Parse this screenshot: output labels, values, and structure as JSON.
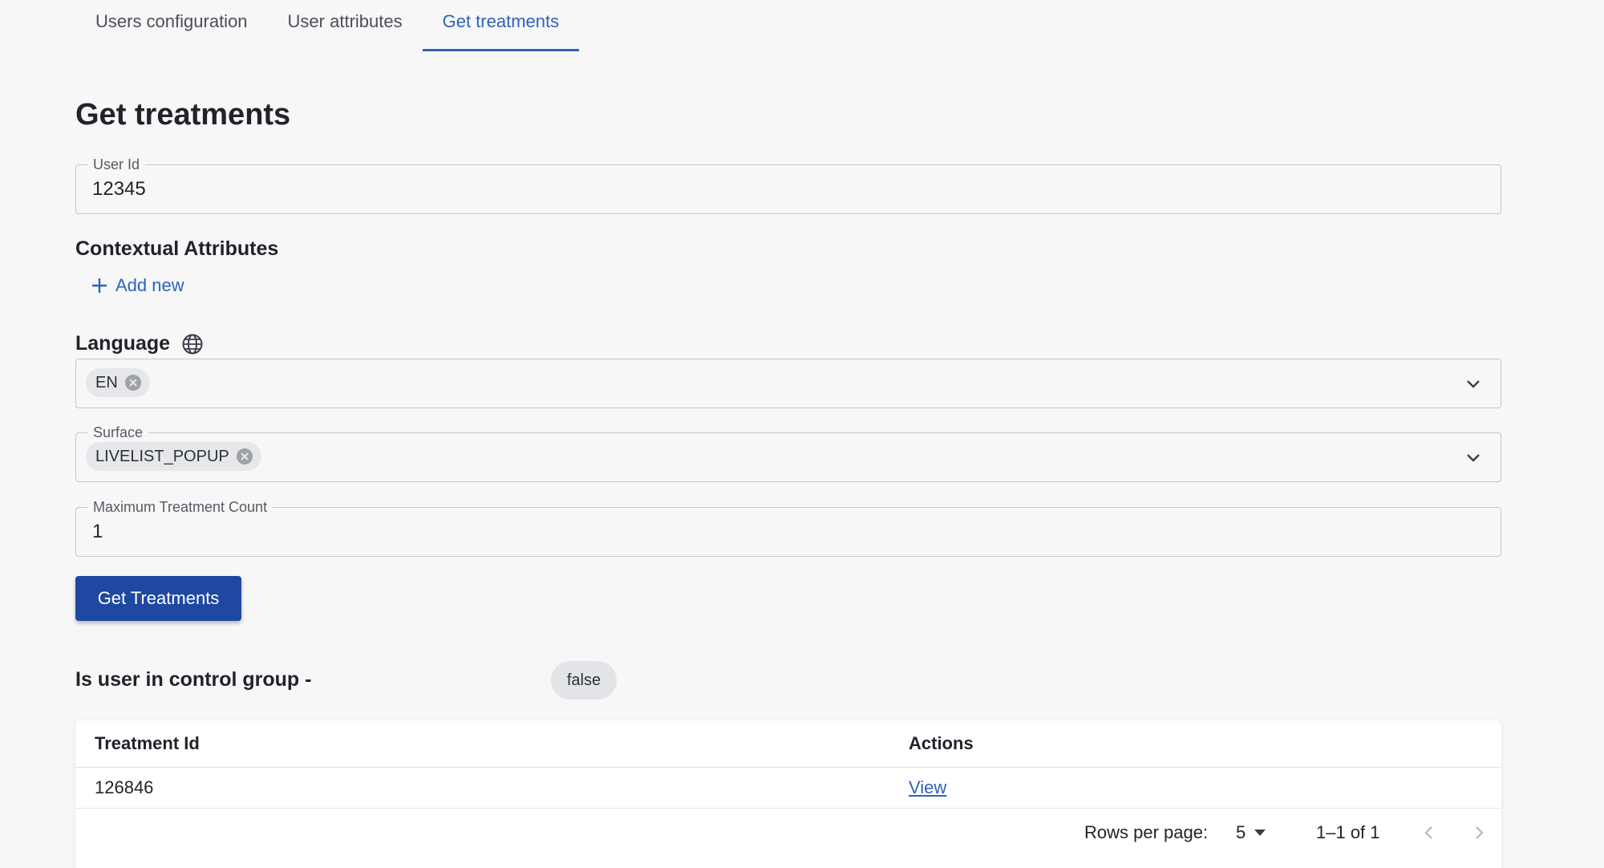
{
  "tabs": [
    {
      "label": "Users configuration"
    },
    {
      "label": "User attributes"
    },
    {
      "label": "Get treatments"
    }
  ],
  "page_title": "Get treatments",
  "user_id": {
    "label": "User Id",
    "value": "12345"
  },
  "contextual_attributes": {
    "heading": "Contextual Attributes",
    "add_label": "Add new"
  },
  "language": {
    "heading": "Language",
    "selected": "EN"
  },
  "surface": {
    "label": "Surface",
    "selected": "LIVELIST_POPUP"
  },
  "max_count": {
    "label": "Maximum Treatment Count",
    "value": "1"
  },
  "submit_label": "Get Treatments",
  "control_group": {
    "label": "Is user in control group -",
    "value": "false"
  },
  "table": {
    "columns": [
      "Treatment Id",
      "Actions"
    ],
    "rows": [
      {
        "treatment_id": "126846",
        "action": "View"
      }
    ]
  },
  "pagination": {
    "rows_per_page_label": "Rows per page:",
    "rows_per_page": "5",
    "range": "1–1 of 1"
  },
  "colors": {
    "accent": "#2f63b8",
    "primary_button": "#1f48a3",
    "background": "#f7f7f8"
  }
}
